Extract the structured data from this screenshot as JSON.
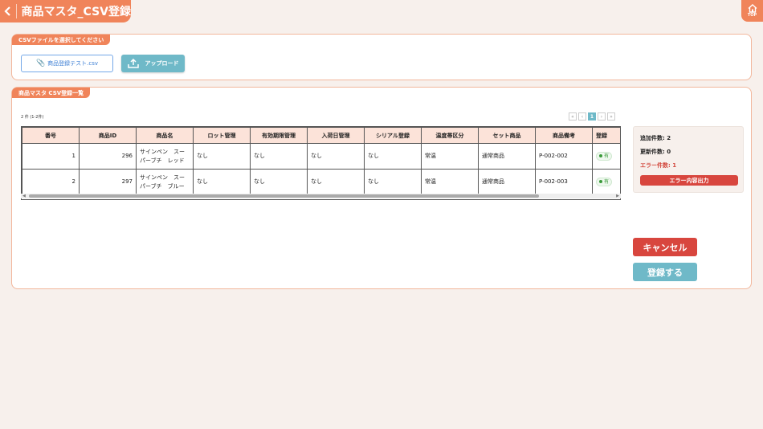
{
  "header": {
    "title": "商品マスタ_CSV登録",
    "back_icon": "chevron-left-icon",
    "top_button_label": "TOP",
    "top_icon": "home-icon"
  },
  "csv_select": {
    "section_label": "CSVファイルを選択してください",
    "file_name": "商品登録テスト.csv",
    "upload_label": "アップロード"
  },
  "list": {
    "section_label": "商品マスタ CSV登録一覧",
    "count_text": "2 件 (1-2件)",
    "pager": {
      "first": "«",
      "prev": "‹",
      "current": "1",
      "next": "›",
      "last": "»"
    },
    "columns": [
      "番号",
      "商品ID",
      "商品名",
      "ロット管理",
      "有効期限管理",
      "入荷日管理",
      "シリアル登録",
      "温度帯区分",
      "セット商品",
      "商品備考",
      "登録"
    ],
    "rows": [
      {
        "no": "1",
        "id": "296",
        "name": "サインペン　スーパーブチ　レッド",
        "lot": "なし",
        "expiry": "なし",
        "arrival": "なし",
        "serial": "なし",
        "temp": "常温",
        "set": "通常商品",
        "note": "P-002-002",
        "status": "有"
      },
      {
        "no": "2",
        "id": "297",
        "name": "サインペン　スーパーブチ　ブルー",
        "lot": "なし",
        "expiry": "なし",
        "arrival": "なし",
        "serial": "なし",
        "temp": "常温",
        "set": "通常商品",
        "note": "P-002-003",
        "status": "有"
      }
    ]
  },
  "summary": {
    "added": "追加件数: 2",
    "updated": "更新件数: 0",
    "errors": "エラー件数: 1",
    "error_export_label": "エラー内容出力"
  },
  "actions": {
    "cancel_label": "キャンセル",
    "register_label": "登録する"
  },
  "colors": {
    "accent": "#f0845a",
    "teal": "#6fb9c8",
    "danger": "#d8463e",
    "header_bg": "#fce3d9",
    "page_bg": "#f7f0ec"
  }
}
